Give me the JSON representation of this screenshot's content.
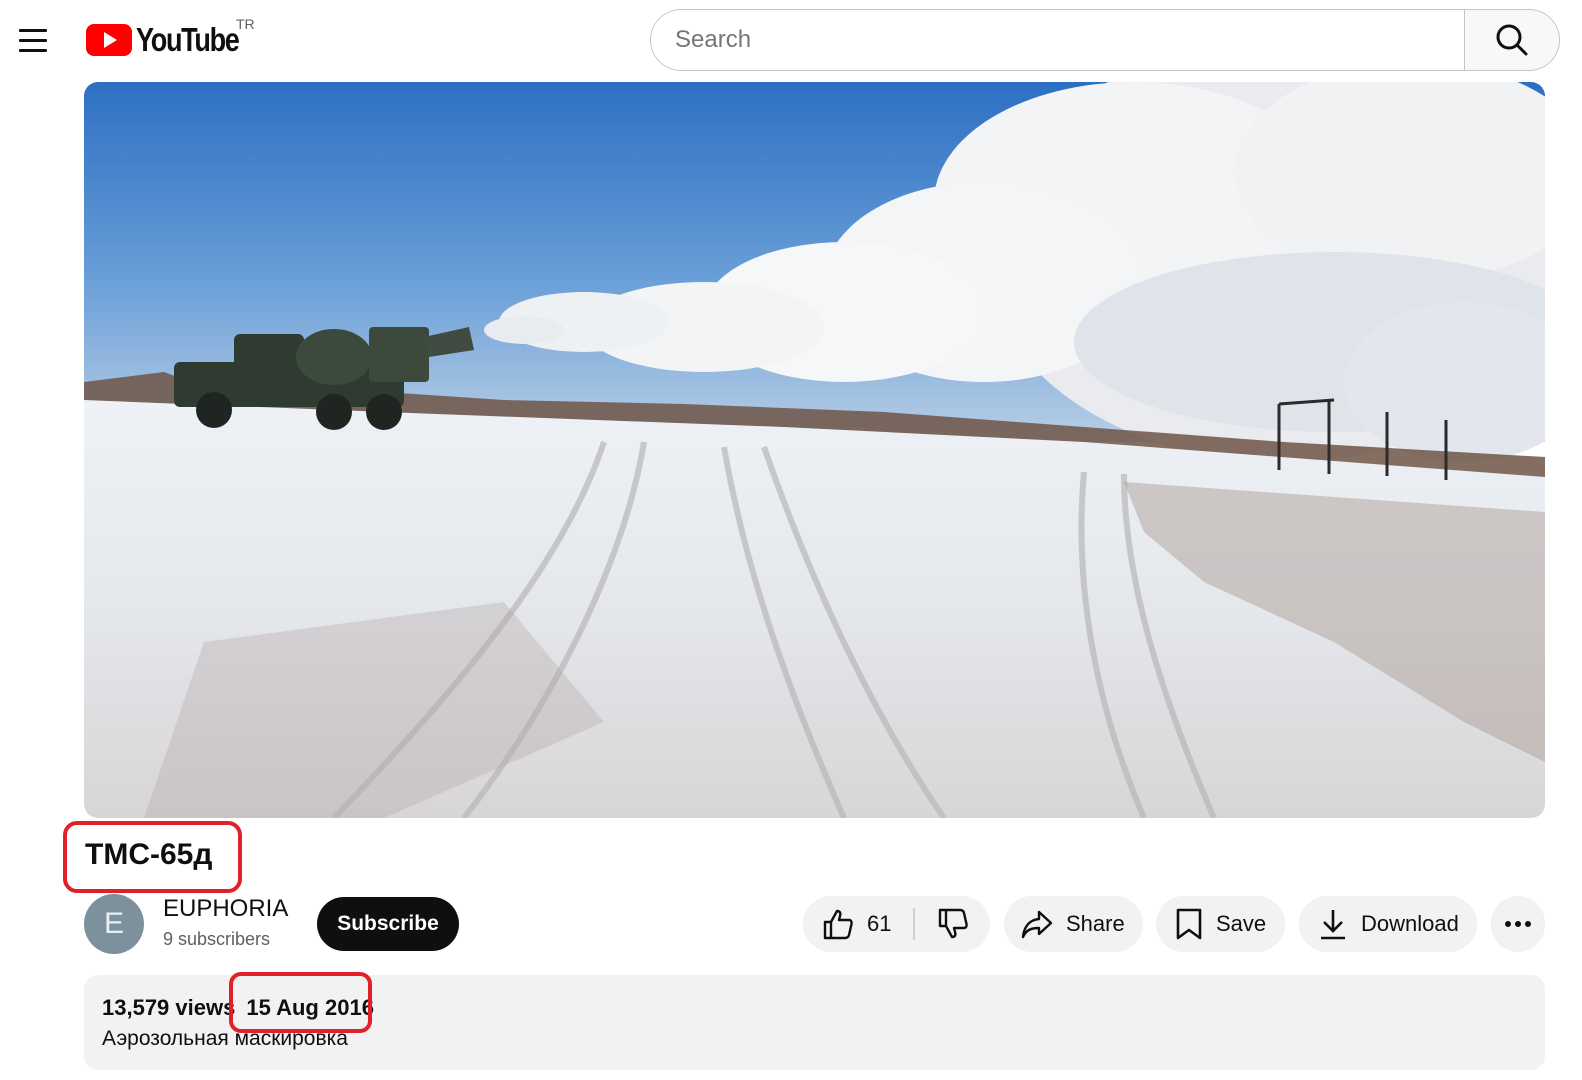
{
  "header": {
    "logo_text": "YouTube",
    "country_code": "TR",
    "search_placeholder": "Search",
    "icons": [
      "menu-icon",
      "youtube-play-icon",
      "search-icon"
    ]
  },
  "video": {
    "title": "ТМС-65д",
    "channel": {
      "avatar_letter": "E",
      "name": "EUPHORIA",
      "subscribers": "9 subscribers",
      "subscribe_label": "Subscribe"
    },
    "actions": {
      "like_count": "61",
      "share_label": "Share",
      "save_label": "Save",
      "download_label": "Download",
      "icons": [
        "thumbs-up-icon",
        "thumbs-down-icon",
        "share-arrow-icon",
        "bookmark-icon",
        "download-icon",
        "more-horiz-icon"
      ]
    },
    "description": {
      "views": "13,579 views",
      "date": "15 Aug 2016",
      "text": "Аэрозольная маскировка"
    }
  },
  "colors": {
    "brand_red": "#ff0000",
    "annotation_red": "#e0202a",
    "subscribe_bg": "#0f0f0f",
    "pill_bg": "#f2f2f2"
  }
}
